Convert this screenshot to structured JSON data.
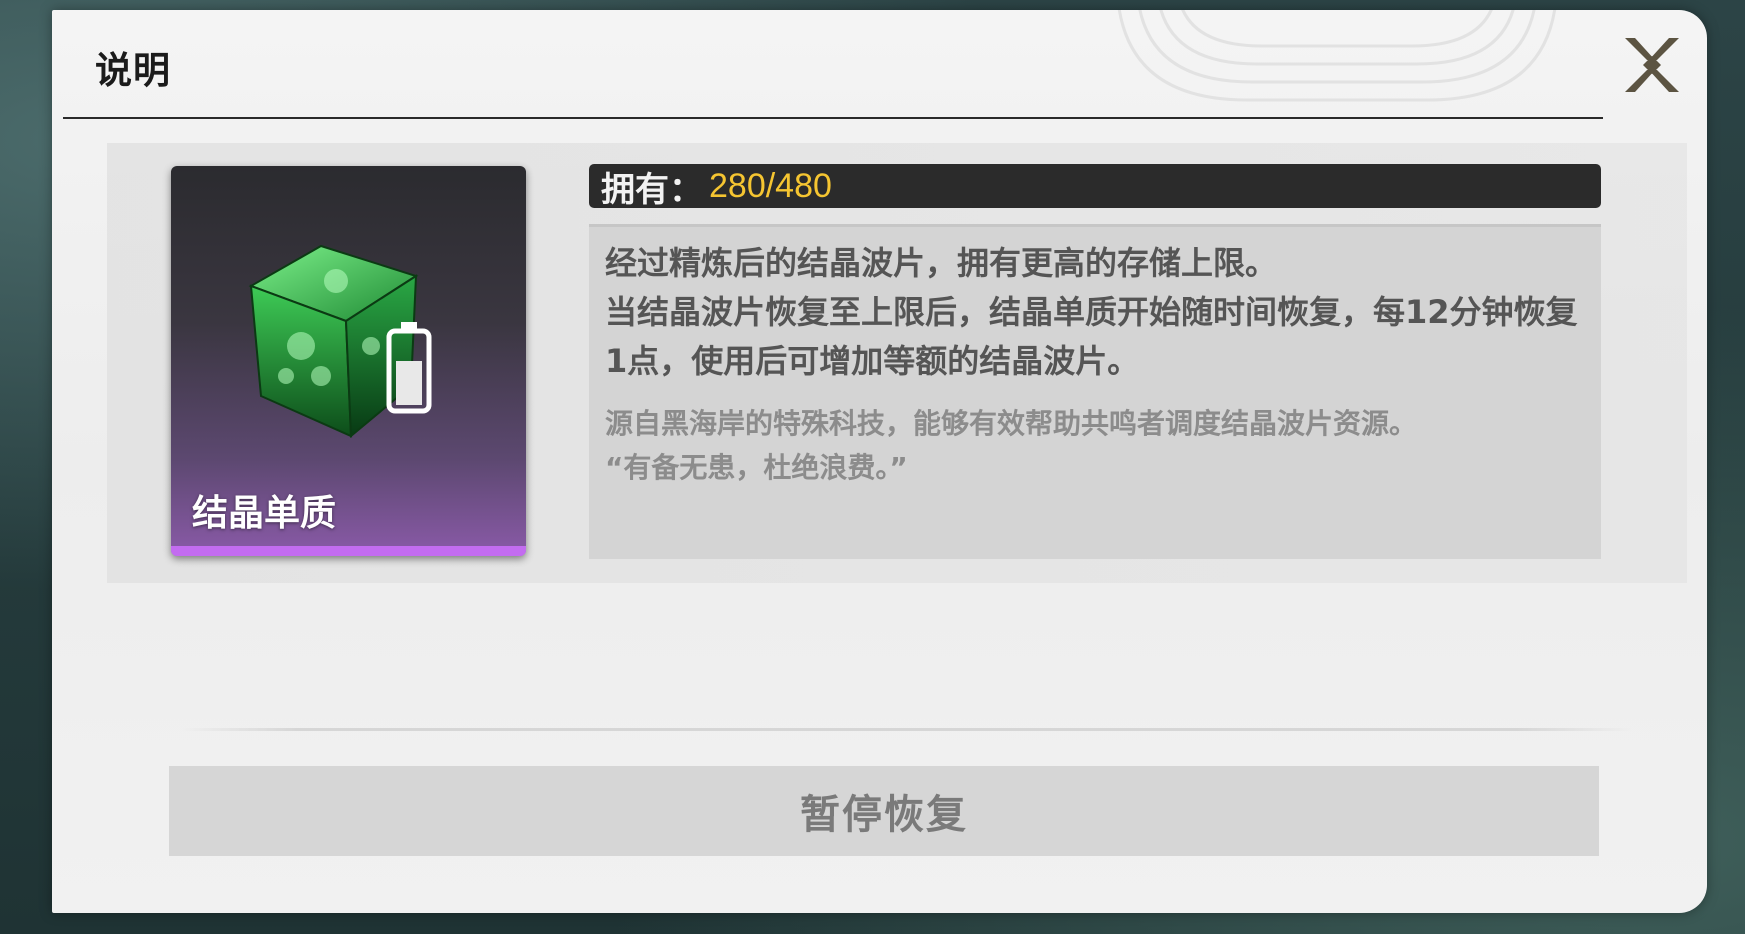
{
  "dialog": {
    "title": "说明",
    "close_icon": "close-x-icon"
  },
  "item": {
    "name": "结晶单质",
    "icon": "green-crystal-cube-battery-icon",
    "rarity_color": "#c36cf0"
  },
  "owned": {
    "label": "拥有：",
    "value": "280/480",
    "value_color": "#f5c531"
  },
  "description": {
    "line1": "经过精炼后的结晶波片，拥有更高的存储上限。",
    "line2": "当结晶波片恢复至上限后，结晶单质开始随时间恢复，每12分钟恢复1点，使用后可增加等额的结晶波片。",
    "flavor1": "源自黑海岸的特殊科技，能够有效帮助共鸣者调度结晶波片资源。",
    "flavor2": "“有备无患，杜绝浪费。”"
  },
  "actions": {
    "pause_label": "暂停恢复"
  }
}
